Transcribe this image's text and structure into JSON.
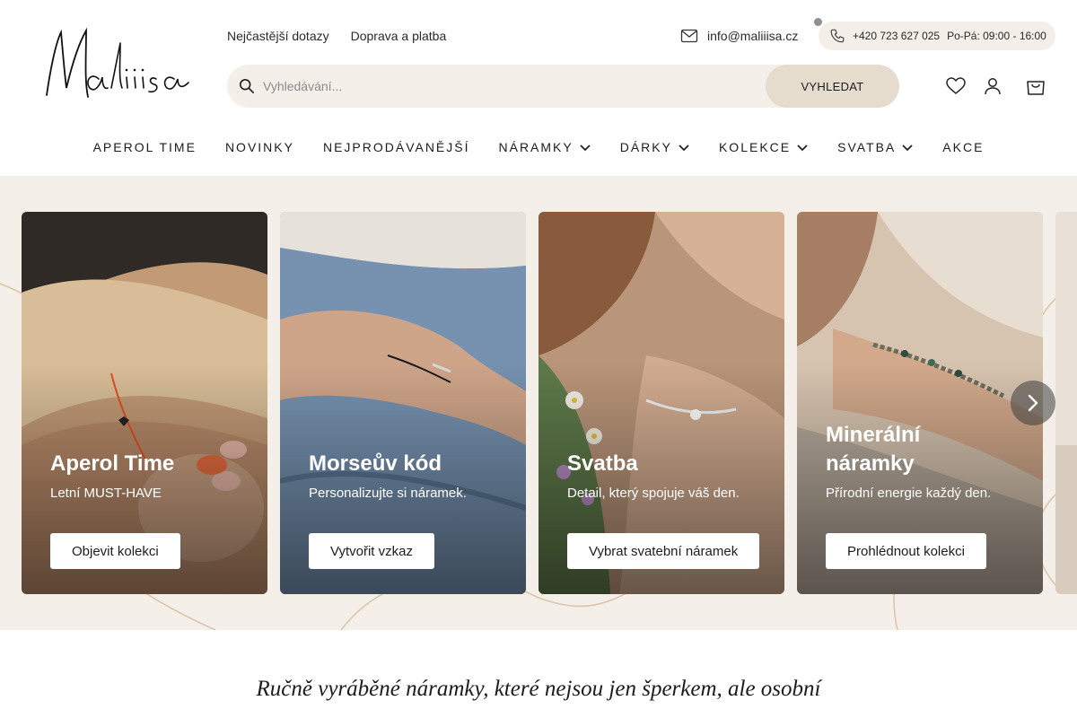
{
  "brand": {
    "logo_text": "Maliiisa"
  },
  "top_links": [
    "Nejčastější dotazy",
    "Doprava a platba"
  ],
  "contact": {
    "email": "info@maliiisa.cz",
    "phone": "+420 723 627 025",
    "hours": "Po-Pá: 09:00 - 16:00"
  },
  "search": {
    "placeholder": "Vyhledávání...",
    "button_label": "VYHLEDAT"
  },
  "header_icons": [
    "heart-icon",
    "user-icon",
    "cart-icon"
  ],
  "nav": [
    {
      "label": "APEROL TIME",
      "dropdown": false
    },
    {
      "label": "NOVINKY",
      "dropdown": false
    },
    {
      "label": "NEJPRODÁVANĚJŠÍ",
      "dropdown": false
    },
    {
      "label": "NÁRAMKY",
      "dropdown": true
    },
    {
      "label": "DÁRKY",
      "dropdown": true
    },
    {
      "label": "KOLEKCE",
      "dropdown": true
    },
    {
      "label": "SVATBA",
      "dropdown": true
    },
    {
      "label": "AKCE",
      "dropdown": false
    }
  ],
  "cards": [
    {
      "title": "Aperol Time",
      "subtitle": "Letní MUST-HAVE",
      "cta": "Objevit kolekci"
    },
    {
      "title": "Morseův kód",
      "subtitle": "Personalizujte si náramek.",
      "cta": "Vytvořit vzkaz"
    },
    {
      "title": "Svatba",
      "subtitle": "Detail, který spojuje váš den.",
      "cta": "Vybrat svatební náramek"
    },
    {
      "title": "Minerální náramky",
      "subtitle": "Přírodní energie každý den.",
      "cta": "Prohlédnout kolekci"
    }
  ],
  "tagline": "Ručně vyráběné náramky, které nejsou jen šperkem, ale osobní",
  "colors": {
    "band": "#f4efe8",
    "search_button": "#e6dccd",
    "text": "#1c1c1c"
  }
}
